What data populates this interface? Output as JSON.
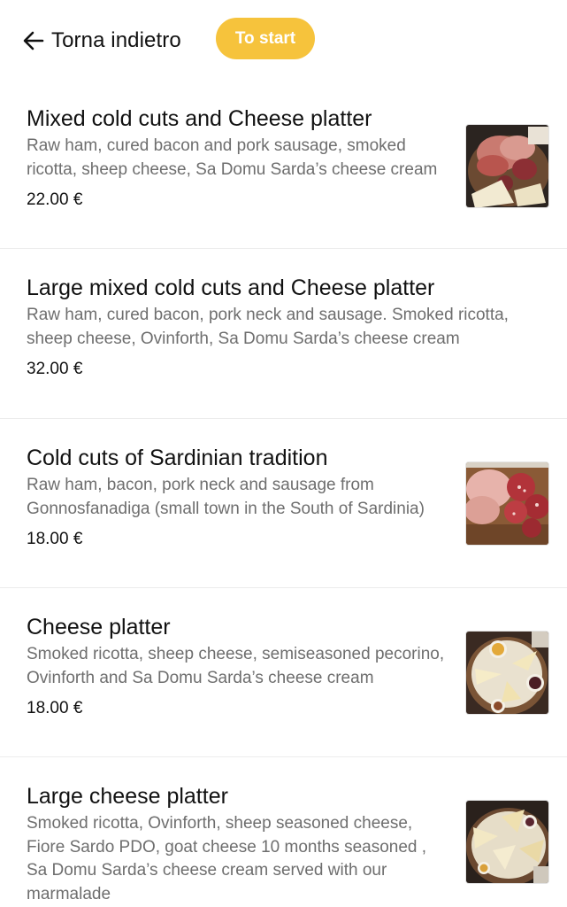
{
  "header": {
    "back_label": "Torna indietro",
    "start_label": "To start",
    "accent_color": "#f6c33c"
  },
  "items": [
    {
      "title": "Mixed cold cuts and Cheese platter",
      "description": "Raw ham, cured bacon and pork sausage, smoked ricotta, sheep cheese, Sa Domu Sarda’s cheese cream",
      "price": "22.00 €",
      "image": "cold-cuts-and-cheese-board"
    },
    {
      "title": "Large mixed cold cuts and Cheese platter",
      "description": "Raw ham, cured bacon, pork neck and sausage. Smoked ricotta, sheep cheese, Ovinforth, Sa Domu Sarda’s cheese cream",
      "price": "32.00 €",
      "image": ""
    },
    {
      "title": "Cold cuts of Sardinian tradition",
      "description": "Raw ham, bacon, pork neck and sausage from Gonnosfanadiga (small town in the South of Sardinia)",
      "price": "18.00 €",
      "image": "sliced-ham-and-salami"
    },
    {
      "title": "Cheese platter",
      "description": "Smoked ricotta, sheep cheese, semiseasoned pecorino, Ovinforth and Sa Domu Sarda’s cheese cream",
      "price": "18.00 €",
      "image": "cheese-board-with-honey-and-jam"
    },
    {
      "title": "Large cheese platter",
      "description": "Smoked ricotta, Ovinforth, sheep seasoned cheese, Fiore Sardo PDO, goat cheese 10 months seasoned , Sa Domu Sarda’s cheese cream served with our marmalade",
      "price": "",
      "image": "large-cheese-board"
    }
  ]
}
